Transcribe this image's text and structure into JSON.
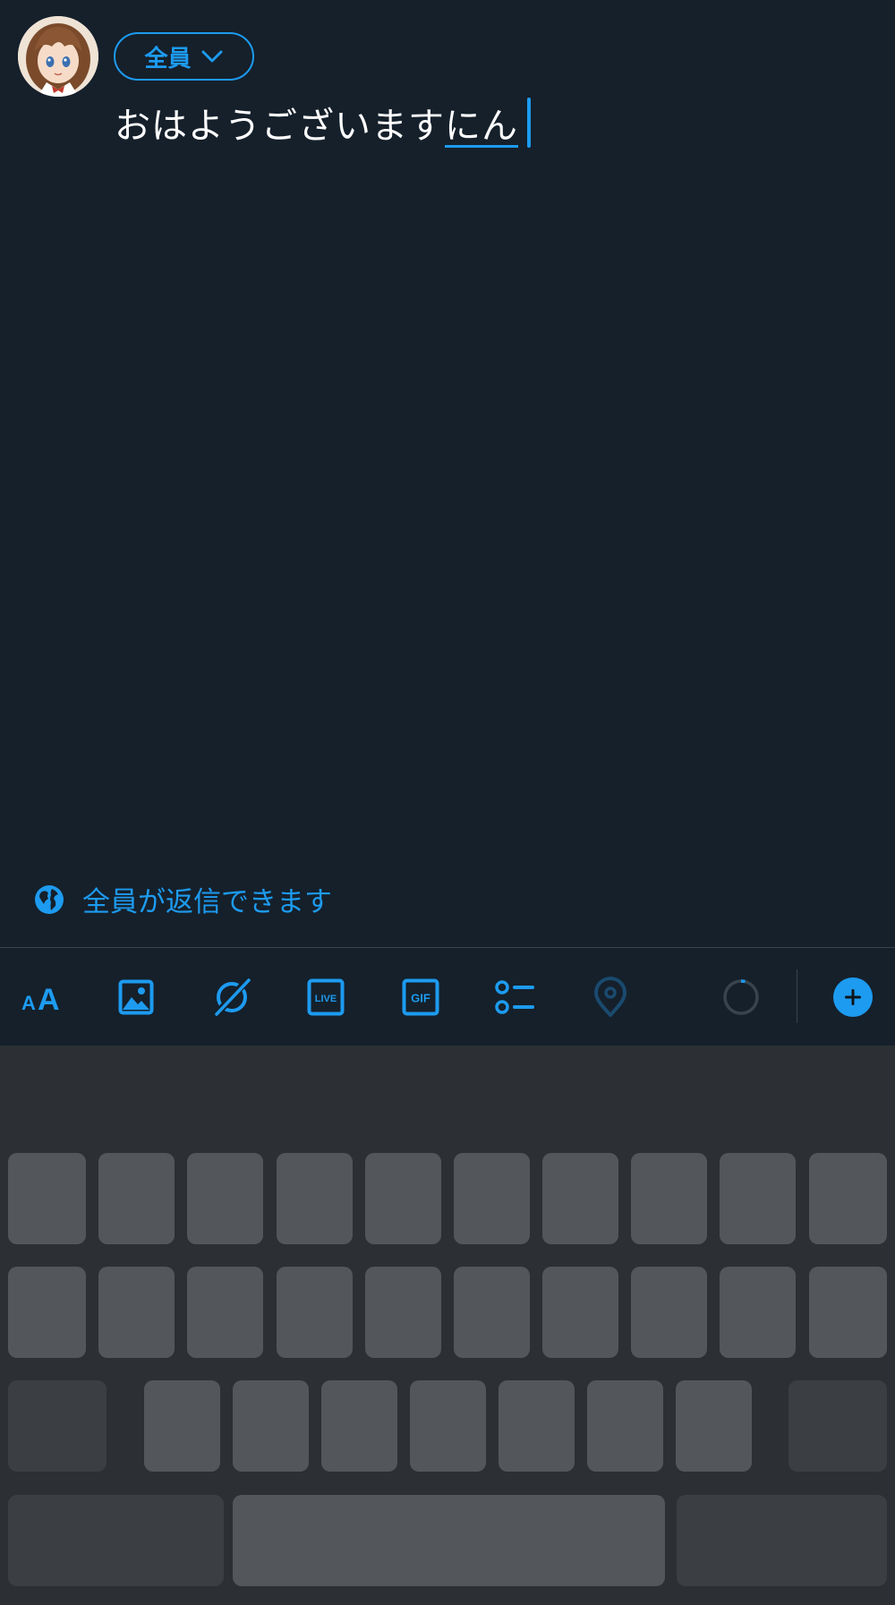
{
  "composer": {
    "audience_label": "全員",
    "text_committed": "おはようございます",
    "text_composing": "にん",
    "reply_setting": "全員が返信できます"
  },
  "toolbar": {
    "items": [
      {
        "name": "text-format",
        "icon": "text-size-icon",
        "glyph": "AA"
      },
      {
        "name": "image",
        "icon": "image-icon"
      },
      {
        "name": "grok",
        "icon": "grok-icon"
      },
      {
        "name": "live",
        "icon": "live-icon",
        "glyph": "LIVE"
      },
      {
        "name": "gif",
        "icon": "gif-icon",
        "glyph": "GIF"
      },
      {
        "name": "poll",
        "icon": "poll-icon"
      },
      {
        "name": "location",
        "icon": "location-icon"
      },
      {
        "name": "char-count",
        "icon": "progress-ring-icon"
      },
      {
        "name": "add-thread",
        "icon": "plus-icon"
      }
    ],
    "char_progress_fraction": 0.04
  },
  "colors": {
    "background": "#15202b",
    "accent": "#1d9bf0",
    "text": "#ffffff",
    "divider": "#38444d",
    "keyboard_bg": "#2c3034",
    "key": "#53575b",
    "key_dark": "#3b3f43",
    "disabled_icon": "#1a4a6e"
  }
}
